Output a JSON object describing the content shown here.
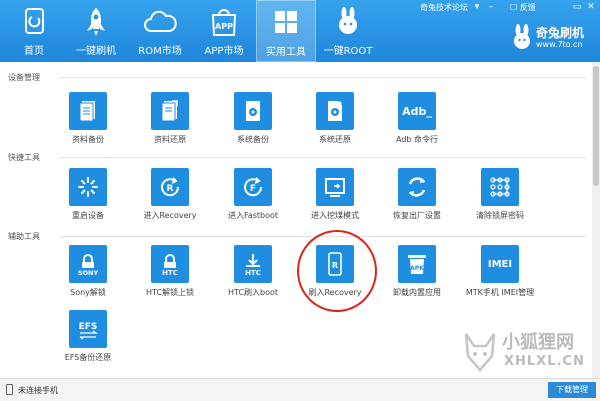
{
  "nav": {
    "items": [
      {
        "label": "首页",
        "icon": "home-icon"
      },
      {
        "label": "一键刷机",
        "icon": "rocket-icon"
      },
      {
        "label": "ROM市场",
        "icon": "cloud-icon"
      },
      {
        "label": "APP市场",
        "icon": "app-bag-icon"
      },
      {
        "label": "实用工具",
        "icon": "tools-grid-icon"
      },
      {
        "label": "一键ROOT",
        "icon": "rabbit-icon"
      }
    ],
    "active": "实用工具"
  },
  "titlebar": {
    "forum_link": "奇兔技术论坛",
    "feedback": "反馈",
    "brand_name": "奇兔刷机",
    "brand_url": "www.7to.cn"
  },
  "sections": [
    {
      "title": "设备管理",
      "tiles": [
        {
          "label": "资料备份",
          "icon": "document-backup-icon"
        },
        {
          "label": "资料还原",
          "icon": "document-restore-icon"
        },
        {
          "label": "系统备份",
          "icon": "system-backup-icon"
        },
        {
          "label": "系统还原",
          "icon": "system-restore-icon"
        },
        {
          "label": "Adb 命令行",
          "icon": "adb-terminal-icon",
          "icon_text": "Adb_"
        }
      ]
    },
    {
      "title": "快捷工具",
      "tiles": [
        {
          "label": "重启设备",
          "icon": "reboot-spinner-icon"
        },
        {
          "label": "进入Recovery",
          "icon": "recovery-r-icon",
          "icon_text": "R"
        },
        {
          "label": "进入Fastboot",
          "icon": "fastboot-f-icon",
          "icon_text": "F"
        },
        {
          "label": "进入挖煤模式",
          "icon": "download-mode-icon"
        },
        {
          "label": "恢复出厂设置",
          "icon": "factory-reset-icon"
        },
        {
          "label": "清除锁屏密码",
          "icon": "pattern-lock-icon"
        }
      ]
    },
    {
      "title": "辅助工具",
      "tiles": [
        {
          "label": "Sony解锁",
          "icon": "sony-unlock-icon",
          "icon_text": "SONY"
        },
        {
          "label": "HTC解锁上锁",
          "icon": "htc-unlock-icon",
          "icon_text": "HTC"
        },
        {
          "label": "HTC刷入boot",
          "icon": "htc-boot-icon",
          "icon_text": "HTC"
        },
        {
          "label": "刷入Recovery",
          "icon": "flash-recovery-icon",
          "icon_text": "R"
        },
        {
          "label": "卸载内置应用",
          "icon": "apk-uninstall-icon",
          "icon_text": "APK"
        },
        {
          "label": "MTK手机 IMEI管理",
          "icon": "imei-icon",
          "icon_text": "IMEI"
        },
        {
          "label": "EFS备份还原",
          "icon": "efs-icon",
          "icon_text": "EFS"
        }
      ]
    }
  ],
  "status": {
    "device_text": "未连接手机",
    "download_button": "下载管理"
  },
  "watermark": {
    "line1": "小狐狸网",
    "line2": "XHLXL.CN"
  },
  "colors": {
    "topbar": "#2a93e4",
    "tile": "#1f8ee0",
    "highlight": "#d9251c"
  }
}
